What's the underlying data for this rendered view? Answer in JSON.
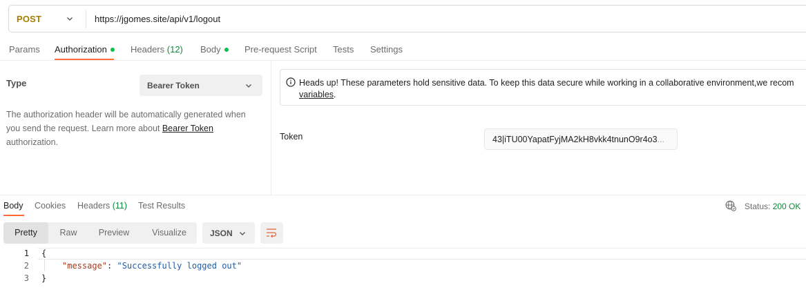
{
  "request": {
    "method": "POST",
    "url": "https://jgomes.site/api/v1/logout",
    "tabs": [
      {
        "label": "Params"
      },
      {
        "label": "Authorization"
      },
      {
        "label": "Headers",
        "count": "(12)"
      },
      {
        "label": "Body"
      },
      {
        "label": "Pre-request Script"
      },
      {
        "label": "Tests"
      },
      {
        "label": "Settings"
      }
    ]
  },
  "auth": {
    "type_label": "Type",
    "type_value": "Bearer Token",
    "desc_prefix": "The authorization header will be automatically generated when you send the request. Learn more about ",
    "desc_link": "Bearer Token",
    "desc_suffix": " authorization.",
    "headsup_text": "Heads up! These parameters hold sensitive data. To keep this data secure while working in a collaborative environment,we recom",
    "headsup_link": "variables",
    "headsup_link_suffix": ".",
    "token_label": "Token",
    "token_value": "43|iTU00YapatFyjMA2kH8vkk4tnunO9r4o3",
    "token_ellipsis": "..."
  },
  "response": {
    "tabs": [
      {
        "label": "Body"
      },
      {
        "label": "Cookies"
      },
      {
        "label": "Headers",
        "count": "(11)"
      },
      {
        "label": "Test Results"
      }
    ],
    "status_label": "Status:",
    "status_value": "200 OK",
    "views": [
      "Pretty",
      "Raw",
      "Preview",
      "Visualize"
    ],
    "format": "JSON",
    "code": {
      "line_numbers": [
        "1",
        "2",
        "3"
      ],
      "open_brace": "{",
      "key": "\"message\"",
      "colon": ": ",
      "value": "\"Successfully logged out\"",
      "close_brace": "}"
    }
  },
  "colors": {
    "accent": "#ff6c37",
    "method_post": "#a77d00",
    "status_ok": "#0c8a3a",
    "dot": "#0cbb52"
  }
}
